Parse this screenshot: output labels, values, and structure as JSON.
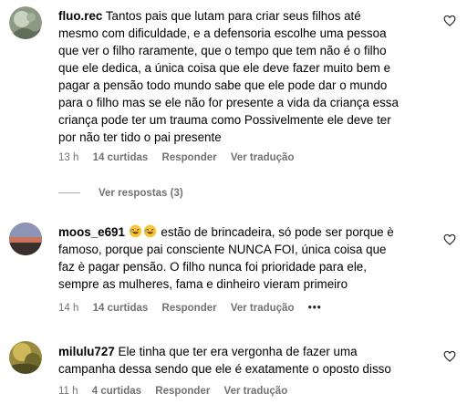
{
  "comments": [
    {
      "username": "fluo.rec",
      "lines": [
        "Tantos pais que lutam para criar seus filhos até",
        "mesmo com dificuldade, e a defensoria escolhe uma pessoa",
        "que ver o filho raramente, que o tempo que tem não é o filho",
        "que ele dedica, a única coisa que ele deve fazer muito bem e",
        "pagar a pensão todo mundo sabe que ele pode dar o mundo",
        "para o filho mas se ele não for presente a vida da criança essa",
        "criança pode ter um trauma como Possivelmente ele deve ter",
        "por não ter tido o pai presente"
      ],
      "time": "13 h",
      "likes": "14 curtidas",
      "reply": "Responder",
      "translate": "Ver tradução",
      "view_replies": "Ver respostas (3)"
    },
    {
      "username": "moos_e691",
      "emojis": [
        "rolling-on-floor-laughing",
        "rolling-on-floor-laughing"
      ],
      "lines": [
        "estão de brincadeira, só pode ser porque è",
        "famoso, porque pai consciente NUNCA FOI, única coisa que",
        "faz è pagar pensão. O filho nunca foi prioridade para ele,",
        "sempre as mulheres, fama e dinheiro vieram primeiro"
      ],
      "time": "14 h",
      "likes": "14 curtidas",
      "reply": "Responder",
      "translate": "Ver tradução",
      "more": "•••"
    },
    {
      "username": "milulu727",
      "lines": [
        "Ele tinha que ter era vergonha de fazer uma",
        "campanha dessa sendo que ele é exatamente o oposto disso"
      ],
      "time": "11 h",
      "likes": "4 curtidas",
      "reply": "Responder",
      "translate": "Ver tradução"
    }
  ],
  "colors": {
    "meta": "#737373",
    "text": "#000000",
    "heart": "#262626"
  },
  "icons": {
    "like": "heart-outline-icon",
    "emoji": "rolling-on-floor-laughing-emoji"
  }
}
